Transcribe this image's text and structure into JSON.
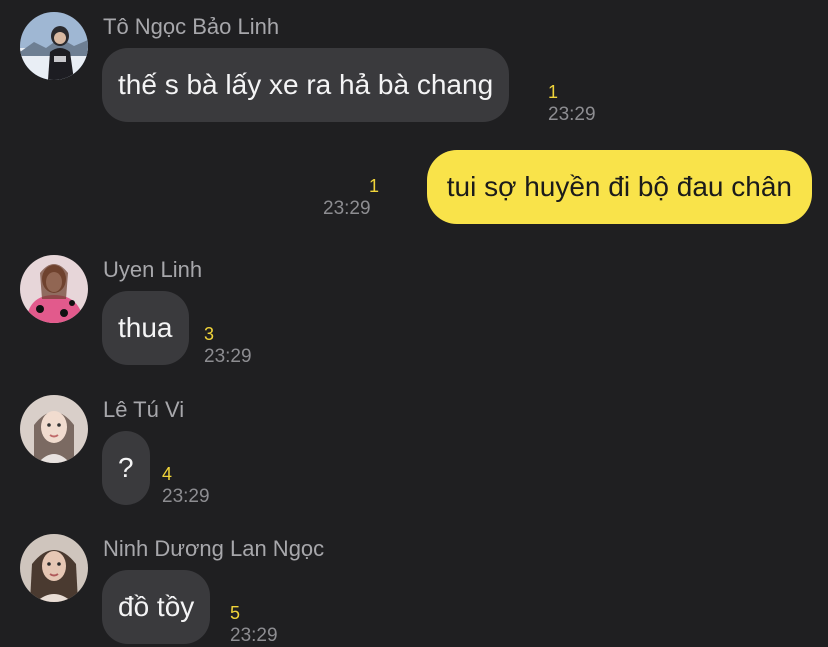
{
  "messages": [
    {
      "sender": "Tô Ngọc Bảo Linh",
      "text": "thế s bà lấy xe ra hả bà chang",
      "unread": "1",
      "time": "23:29",
      "avatar": "avatar-photo-snow"
    },
    {
      "sender": "",
      "text": "tui sợ huyền đi bộ đau chân",
      "unread": "1",
      "time": "23:29",
      "outgoing": true
    },
    {
      "sender": "Uyen Linh",
      "text": "thua",
      "unread": "3",
      "time": "23:29",
      "avatar": "avatar-photo-pink"
    },
    {
      "sender": "Lê Tú Vi",
      "text": "?",
      "unread": "4",
      "time": "23:29",
      "avatar": "avatar-photo-portrait"
    },
    {
      "sender": "Ninh Dương Lan Ngọc",
      "text": "đồ tồy",
      "unread": "5",
      "time": "23:29",
      "avatar": "avatar-photo-portrait-2"
    }
  ],
  "colors": {
    "background": "#1f1f21",
    "incoming_bubble": "#3a3a3d",
    "outgoing_bubble": "#f9e34a",
    "unread_count": "#f0d43a"
  }
}
